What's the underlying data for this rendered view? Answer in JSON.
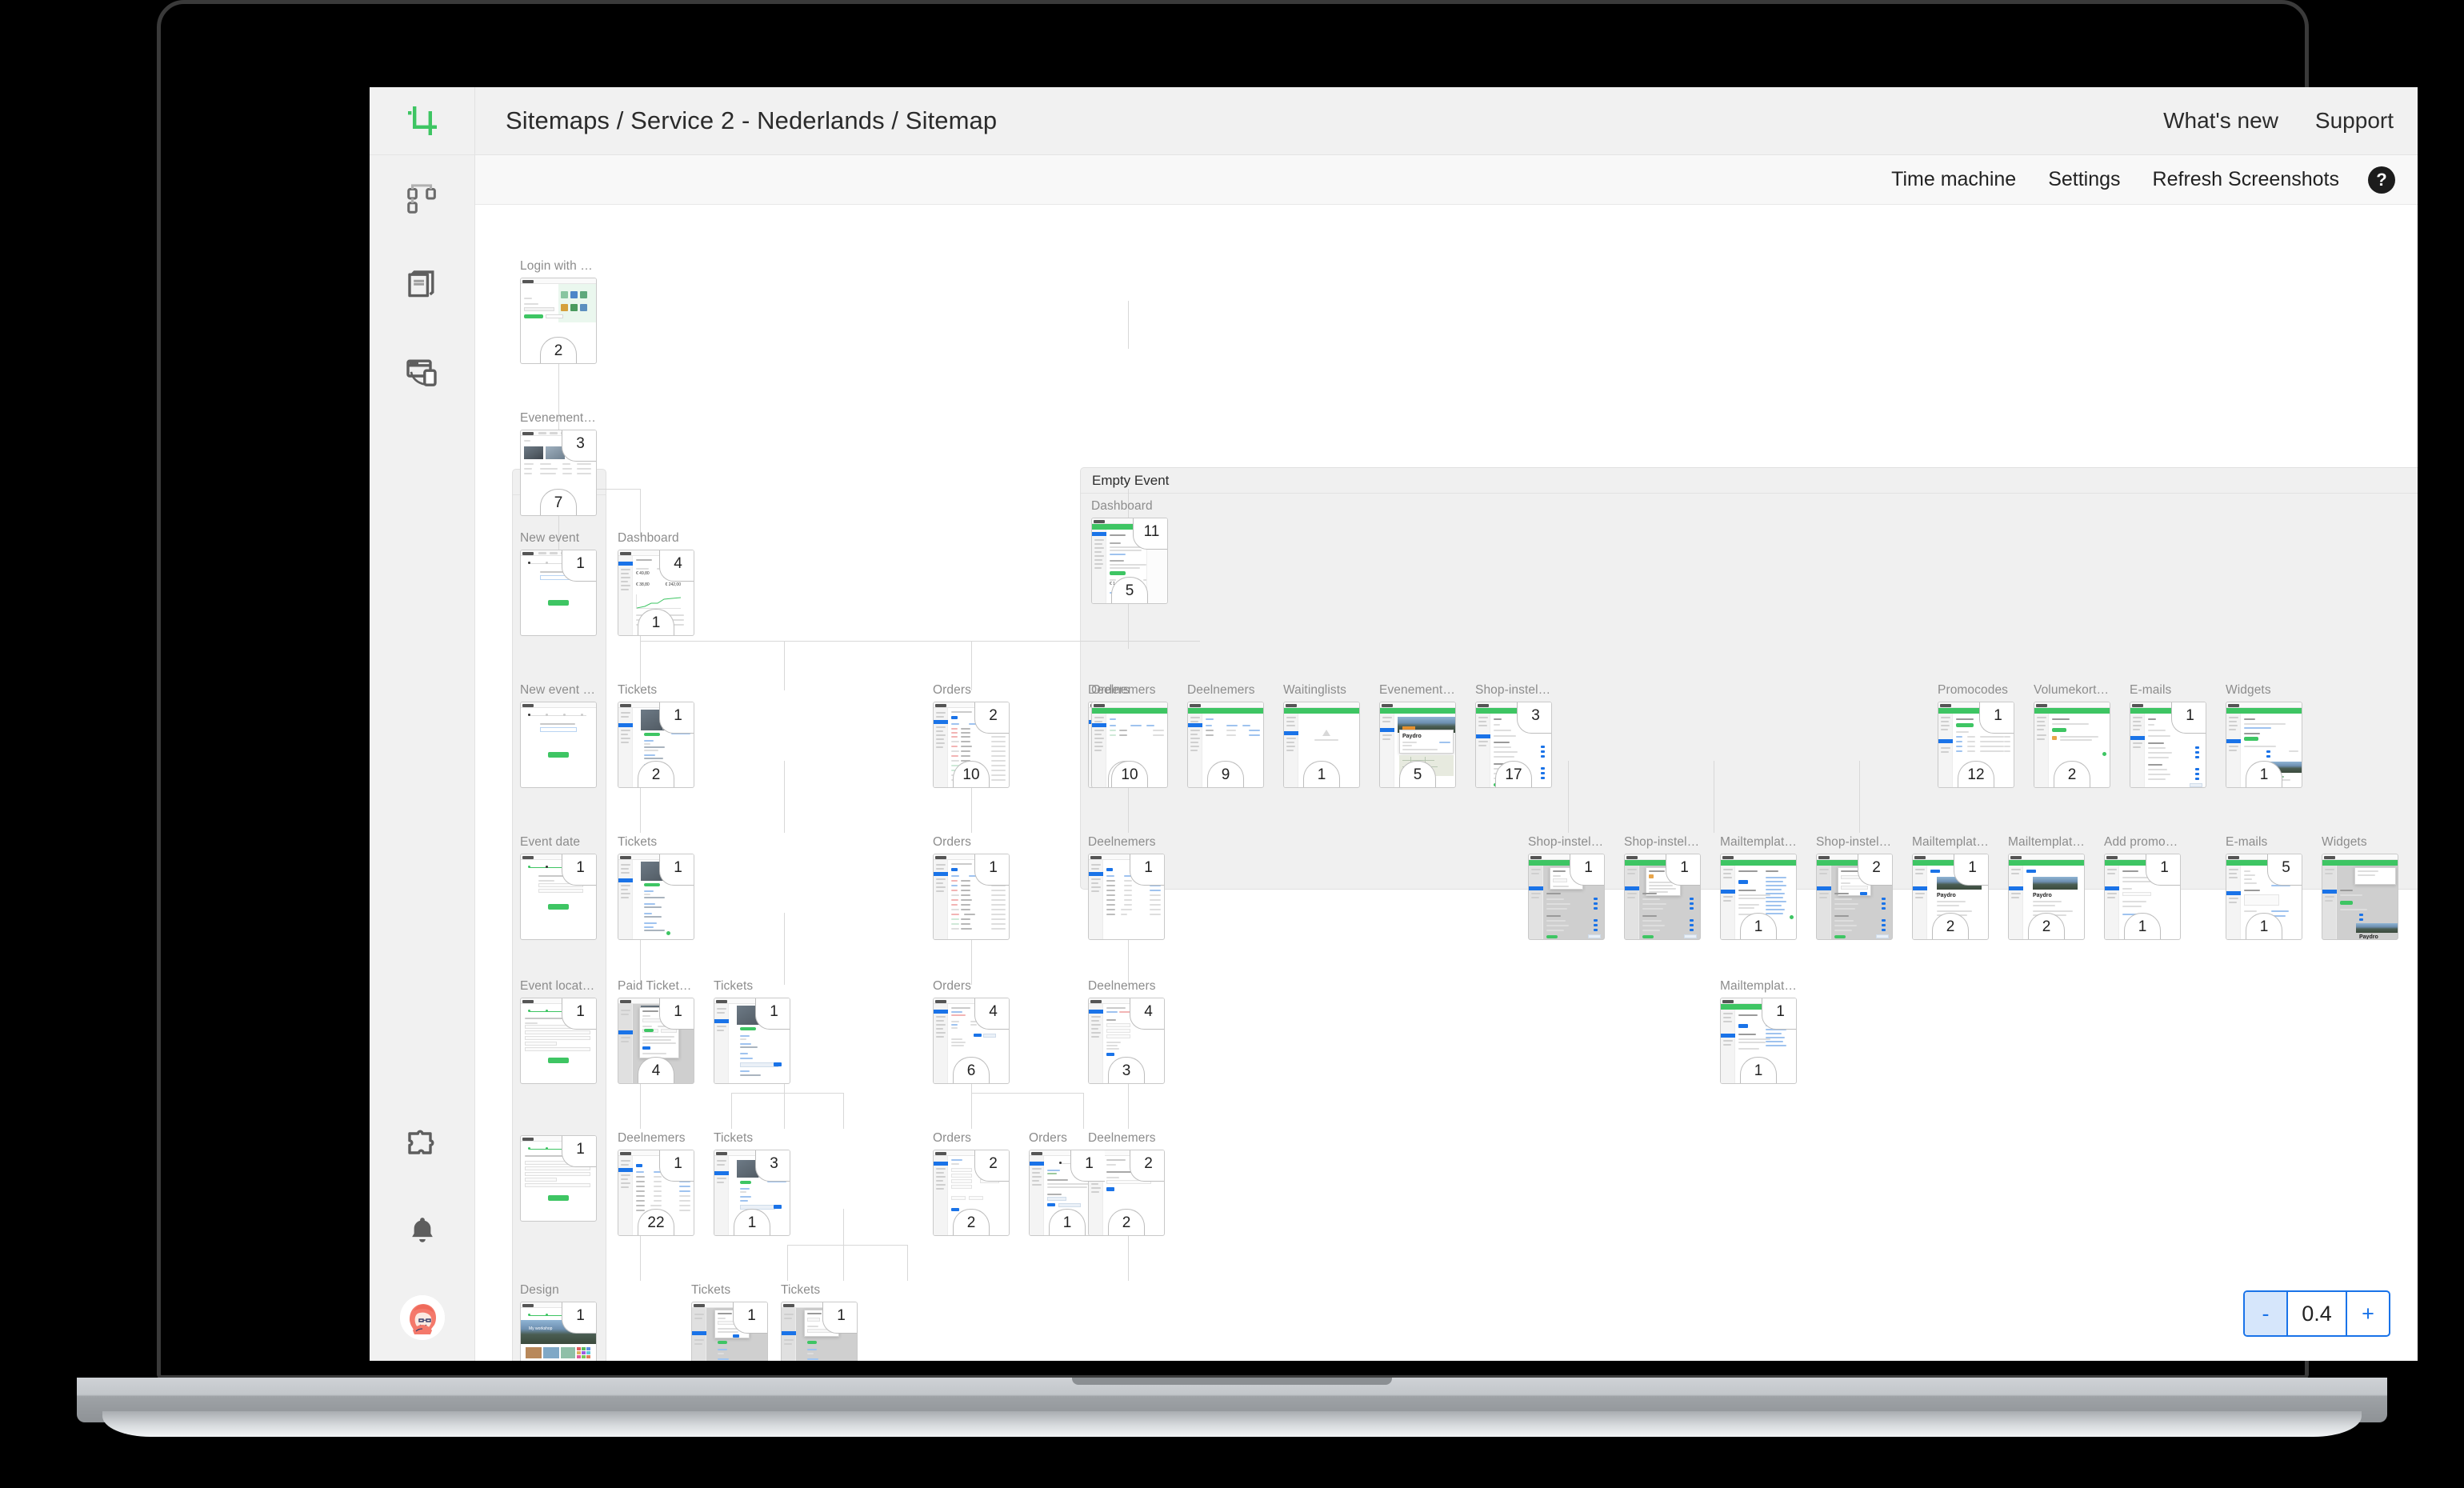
{
  "window": {
    "breadcrumb": "Sitemaps / Service 2 - Nederlands / Sitemap"
  },
  "topnav": {
    "whats_new": "What's new",
    "support": "Support"
  },
  "toolbar": {
    "time_machine": "Time machine",
    "settings": "Settings",
    "refresh_screenshots": "Refresh Screenshots",
    "help": "?"
  },
  "sidebar": {
    "items": [
      {
        "icon": "crop-logo-icon",
        "name": "app-logo"
      },
      {
        "icon": "sitemap-tree-icon",
        "name": "sidebar-item-sitemaps"
      },
      {
        "icon": "book-icon",
        "name": "sidebar-item-library"
      },
      {
        "icon": "browser-device-icon",
        "name": "sidebar-item-devices"
      },
      {
        "icon": "puzzle-icon",
        "name": "sidebar-item-integrations"
      },
      {
        "icon": "bell-icon",
        "name": "sidebar-item-notifications"
      },
      {
        "icon": "avatar-icon",
        "name": "sidebar-item-account"
      }
    ]
  },
  "zoom_control": {
    "minus_label": "-",
    "value": "0.4",
    "plus_label": "+",
    "accent": "#1a73e8"
  },
  "canvas": {
    "groups": [
      {
        "id": "g-new-event",
        "title": "New event"
      },
      {
        "id": "g-empty-event",
        "title": "Empty Event"
      }
    ],
    "nodes": [
      {
        "id": "n1",
        "label": "Login with your s...",
        "badge_tr": "",
        "badge_bc": "2"
      },
      {
        "id": "n2",
        "label": "Evenementen",
        "badge_tr": "3",
        "badge_bc": "7"
      },
      {
        "id": "n3",
        "label": "New event",
        "badge_tr": "1",
        "badge_bc": ""
      },
      {
        "id": "n4",
        "label": "Dashboard",
        "badge_tr": "4",
        "badge_bc": "1"
      },
      {
        "id": "n5",
        "label": "New event event-n...",
        "badge_tr": "",
        "badge_bc": ""
      },
      {
        "id": "n6",
        "label": "Tickets",
        "badge_tr": "1",
        "badge_bc": "2"
      },
      {
        "id": "n7",
        "label": "Orders",
        "badge_tr": "2",
        "badge_bc": "10"
      },
      {
        "id": "n8",
        "label": "Deelnemers",
        "badge_tr": "",
        "badge_bc": "22"
      },
      {
        "id": "n9",
        "label": "Event date",
        "badge_tr": "1",
        "badge_bc": ""
      },
      {
        "id": "n10",
        "label": "Tickets",
        "badge_tr": "1",
        "badge_bc": ""
      },
      {
        "id": "n11",
        "label": "Orders",
        "badge_tr": "1",
        "badge_bc": ""
      },
      {
        "id": "n12",
        "label": "Deelnemers",
        "badge_tr": "1",
        "badge_bc": ""
      },
      {
        "id": "n13",
        "label": "Event location",
        "badge_tr": "1",
        "badge_bc": ""
      },
      {
        "id": "n14",
        "label": "Paid Tickets SS",
        "badge_tr": "1",
        "badge_bc": "4"
      },
      {
        "id": "n15",
        "label": "Tickets",
        "badge_tr": "1",
        "badge_bc": ""
      },
      {
        "id": "n16",
        "label": "Orders",
        "badge_tr": "4",
        "badge_bc": "6"
      },
      {
        "id": "n17",
        "label": "Deelnemers",
        "badge_tr": "4",
        "badge_bc": "3"
      },
      {
        "id": "n18",
        "label": "",
        "badge_tr": "1",
        "badge_bc": ""
      },
      {
        "id": "n19",
        "label": "Deelnemers",
        "badge_tr": "1",
        "badge_bc": "22"
      },
      {
        "id": "n20",
        "label": "Tickets",
        "badge_tr": "3",
        "badge_bc": "1"
      },
      {
        "id": "n21",
        "label": "Orders",
        "badge_tr": "2",
        "badge_bc": "2"
      },
      {
        "id": "n22",
        "label": "Orders",
        "badge_tr": "1",
        "badge_bc": "1"
      },
      {
        "id": "n23",
        "label": "Deelnemers",
        "badge_tr": "2",
        "badge_bc": "2"
      },
      {
        "id": "n24",
        "label": "Design",
        "badge_tr": "1",
        "badge_bc": ""
      },
      {
        "id": "n25",
        "label": "Tickets",
        "badge_tr": "1",
        "badge_bc": ""
      },
      {
        "id": "n26",
        "label": "Tickets",
        "badge_tr": "1",
        "badge_bc": ""
      },
      {
        "id": "e1",
        "label": "Dashboard",
        "badge_tr": "11",
        "badge_bc": "5"
      },
      {
        "id": "e2",
        "label": "Orders",
        "badge_tr": "",
        "badge_bc": "10"
      },
      {
        "id": "e3",
        "label": "Deelnemers",
        "badge_tr": "",
        "badge_bc": "9"
      },
      {
        "id": "e4",
        "label": "Waitinglists",
        "badge_tr": "",
        "badge_bc": "1"
      },
      {
        "id": "e5",
        "label": "Evenement instelli...",
        "badge_tr": "",
        "badge_bc": "5"
      },
      {
        "id": "e6",
        "label": "Shop-instellingen",
        "badge_tr": "3",
        "badge_bc": "17"
      },
      {
        "id": "e7",
        "label": "Promocodes",
        "badge_tr": "1",
        "badge_bc": "12"
      },
      {
        "id": "e8",
        "label": "Volumekorting",
        "badge_tr": "",
        "badge_bc": "2"
      },
      {
        "id": "e9",
        "label": "E-mails",
        "badge_tr": "1",
        "badge_bc": ""
      },
      {
        "id": "e10",
        "label": "Widgets",
        "badge_tr": "",
        "badge_bc": "1"
      },
      {
        "id": "e11",
        "label": "Shop-instellingen",
        "badge_tr": "1",
        "badge_bc": ""
      },
      {
        "id": "e12",
        "label": "Shop-instellingen",
        "badge_tr": "1",
        "badge_bc": ""
      },
      {
        "id": "e13",
        "label": "Mailtemplates",
        "badge_tr": "",
        "badge_bc": "1"
      },
      {
        "id": "e14",
        "label": "Shop-instellingen",
        "badge_tr": "2",
        "badge_bc": ""
      },
      {
        "id": "e15",
        "label": "Mailtemplates",
        "badge_tr": "1",
        "badge_bc": "2"
      },
      {
        "id": "e16",
        "label": "Mailtemplates",
        "badge_tr": "",
        "badge_bc": "2"
      },
      {
        "id": "e17",
        "label": "Add promocode",
        "badge_tr": "1",
        "badge_bc": "1"
      },
      {
        "id": "e18",
        "label": "E-mails",
        "badge_tr": "5",
        "badge_bc": "1"
      },
      {
        "id": "e19",
        "label": "Widgets",
        "badge_tr": "",
        "badge_bc": ""
      },
      {
        "id": "e20",
        "label": "Mailtemplates",
        "badge_tr": "1",
        "badge_bc": "1"
      }
    ]
  }
}
